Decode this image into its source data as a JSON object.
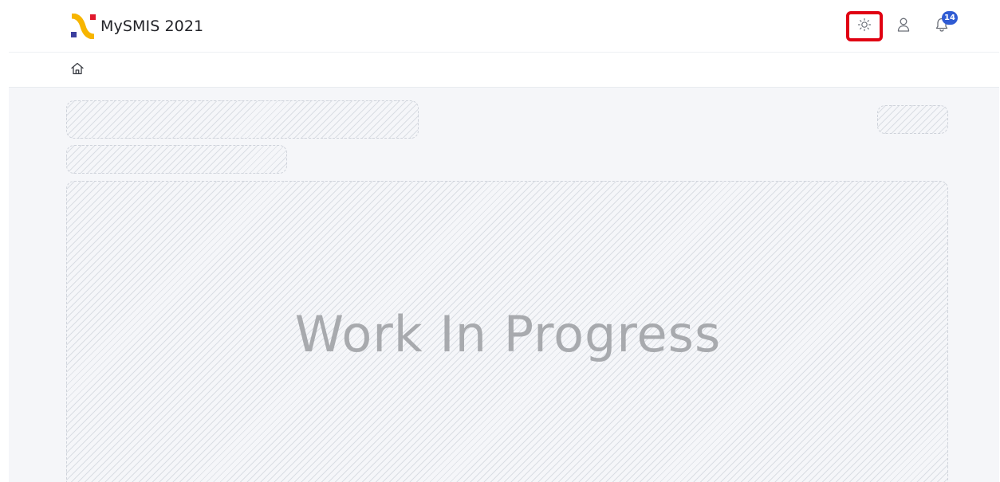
{
  "app": {
    "title": "MySMIS 2021",
    "logo_icon": "mysmis-logo-icon",
    "colors": {
      "logo_yellow": "#f7b500",
      "logo_red": "#e0182d",
      "logo_navy": "#3b3f9e",
      "highlight_red": "#e00012",
      "badge_blue": "#2f5bd3"
    }
  },
  "header": {
    "theme_toggle_icon": "sun-icon",
    "user_icon": "user-icon",
    "notifications_icon": "bell-icon",
    "notifications_count": "14"
  },
  "breadcrumb": {
    "home_icon": "home-icon"
  },
  "main": {
    "placeholder_message": "Work In Progress"
  }
}
